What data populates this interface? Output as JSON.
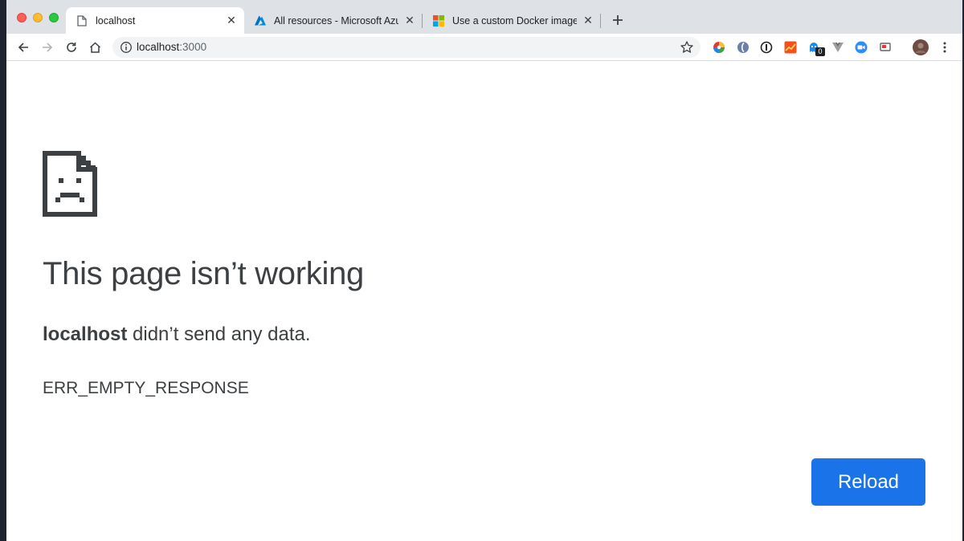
{
  "tabs": [
    {
      "title": "localhost",
      "icon": "document-icon",
      "active": true
    },
    {
      "title": "All resources - Microsoft Azure",
      "icon": "azure-icon",
      "active": false
    },
    {
      "title": "Use a custom Docker image fo",
      "icon": "microsoft-icon",
      "active": false
    }
  ],
  "omnibox": {
    "host": "localhost",
    "port": ":3000"
  },
  "error": {
    "headline": "This page isn’t working",
    "host": "localhost",
    "message": " didn’t send any data.",
    "code": "ERR_EMPTY_RESPONSE",
    "reload_label": "Reload"
  },
  "extensions": {
    "badge_count": "0"
  },
  "colors": {
    "accent": "#1a73e8",
    "text": "#3c4043"
  }
}
